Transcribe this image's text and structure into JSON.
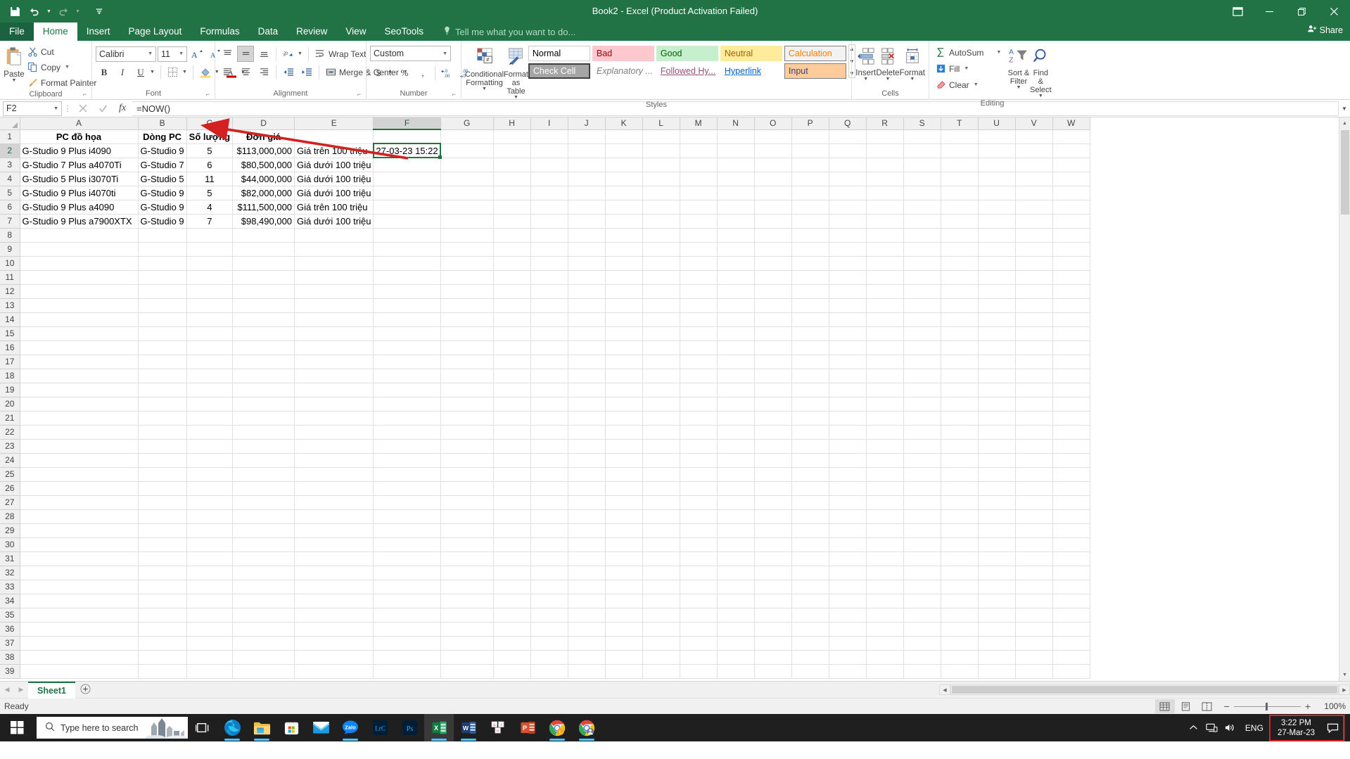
{
  "titlebar": {
    "title": "Book2 - Excel (Product Activation Failed)",
    "qat": [
      {
        "name": "save-icon",
        "label": "Save"
      },
      {
        "name": "undo-icon",
        "label": "Undo"
      },
      {
        "name": "redo-icon",
        "label": "Redo"
      },
      {
        "name": "customize-qat-icon",
        "label": "Customize Quick Access Toolbar"
      }
    ],
    "window_controls": [
      {
        "name": "ribbon-display-options",
        "label": "Ribbon Display Options"
      },
      {
        "name": "minimize",
        "label": "Minimize"
      },
      {
        "name": "restore",
        "label": "Restore Down"
      },
      {
        "name": "close",
        "label": "Close"
      }
    ]
  },
  "tabs": {
    "file": "File",
    "items": [
      "Home",
      "Insert",
      "Page Layout",
      "Formulas",
      "Data",
      "Review",
      "View",
      "SeoTools"
    ],
    "active": "Home",
    "tellme": "Tell me what you want to do...",
    "share": "Share"
  },
  "ribbon": {
    "clipboard": {
      "label": "Clipboard",
      "paste": "Paste",
      "cut": "Cut",
      "copy": "Copy",
      "format_painter": "Format Painter"
    },
    "font": {
      "label": "Font",
      "family": "Calibri",
      "size": "11",
      "grow": "A",
      "shrink": "A",
      "bold": "B",
      "italic": "I",
      "underline": "U",
      "borders": "Borders",
      "fill_color": "Fill Color",
      "font_color": "Font Color"
    },
    "alignment": {
      "label": "Alignment",
      "wrap_text": "Wrap Text",
      "merge_center": "Merge & Center",
      "orientation": "Orientation",
      "decrease_indent": "Decrease Indent",
      "increase_indent": "Increase Indent"
    },
    "number": {
      "label": "Number",
      "format": "Custom",
      "accounting": "$",
      "percent": "%",
      "comma": ",",
      "decrease_decimal": "Decrease Decimal",
      "increase_decimal": "Increase Decimal"
    },
    "styles": {
      "label": "Styles",
      "conditional_formatting": "Conditional Formatting",
      "format_as_table": "Format as Table",
      "gallery": [
        {
          "label": "Normal",
          "bg": "#ffffff",
          "fg": "#000000",
          "border": "#cccccc"
        },
        {
          "label": "Bad",
          "bg": "#ffc7ce",
          "fg": "#9c0006",
          "border": "#ffc7ce"
        },
        {
          "label": "Good",
          "bg": "#c6efce",
          "fg": "#006100",
          "border": "#c6efce"
        },
        {
          "label": "Neutral",
          "bg": "#ffeb9c",
          "fg": "#9c6500",
          "border": "#ffeb9c"
        },
        {
          "label": "Calculation",
          "bg": "#f2f2f2",
          "fg": "#fa7d00",
          "border": "#7f7f7f"
        },
        {
          "label": "Check Cell",
          "bg": "#a5a5a5",
          "fg": "#ffffff",
          "border": "#3f3f3f"
        },
        {
          "label": "Explanatory ...",
          "bg": "#ffffff",
          "fg": "#7f7f7f",
          "border": "#ffffff"
        },
        {
          "label": "Followed Hy...",
          "bg": "#ffffff",
          "fg": "#954f72",
          "border": "#ffffff"
        },
        {
          "label": "Hyperlink",
          "bg": "#ffffff",
          "fg": "#0563c1",
          "border": "#ffffff"
        },
        {
          "label": "Input",
          "bg": "#ffcc99",
          "fg": "#3f3f76",
          "border": "#7f7f7f"
        }
      ]
    },
    "cells": {
      "label": "Cells",
      "insert": "Insert",
      "delete": "Delete",
      "format": "Format"
    },
    "editing": {
      "label": "Editing",
      "autosum": "AutoSum",
      "fill": "Fill",
      "clear": "Clear",
      "sort_filter": "Sort & Filter",
      "find_select": "Find & Select"
    }
  },
  "formula_bar": {
    "name_box": "F2",
    "cancel": "Cancel",
    "enter": "Enter",
    "insert_function": "fx",
    "formula": "=NOW()"
  },
  "grid": {
    "columns": [
      "A",
      "B",
      "C",
      "D",
      "E",
      "F",
      "G",
      "H",
      "I",
      "J",
      "K",
      "L",
      "M",
      "N",
      "O",
      "P",
      "Q",
      "R",
      "S",
      "T",
      "U",
      "V",
      "W"
    ],
    "active_column": "F",
    "active_row": 2,
    "row_count": 39,
    "headers": [
      "PC đồ họa",
      "Dòng PC",
      "Số lượng",
      "Đơn giá",
      "",
      ""
    ],
    "rows": [
      {
        "a": "G-Studio 9 Plus i4090",
        "b": "G-Studio 9",
        "c": "5",
        "d": "$113,000,000",
        "e": "Giá trên 100 triệu",
        "f": "27-03-23 15:22"
      },
      {
        "a": "G-Studio 7 Plus a4070Ti",
        "b": "G-Studio 7",
        "c": "6",
        "d": "$80,500,000",
        "e": "Giá dưới 100 triệu",
        "f": ""
      },
      {
        "a": "G-Studio 5 Plus i3070Ti",
        "b": "G-Studio 5",
        "c": "11",
        "d": "$44,000,000",
        "e": "Giá dưới 100 triệu",
        "f": ""
      },
      {
        "a": "G-Studio 9 Plus i4070ti",
        "b": "G-Studio 9",
        "c": "5",
        "d": "$82,000,000",
        "e": "Giá dưới 100 triệu",
        "f": ""
      },
      {
        "a": "G-Studio 9 Plus a4090",
        "b": "G-Studio 9",
        "c": "4",
        "d": "$111,500,000",
        "e": "Giá trên 100 triệu",
        "f": ""
      },
      {
        "a": "G-Studio 9 Plus a7900XTX",
        "b": "G-Studio 9",
        "c": "7",
        "d": "$98,490,000",
        "e": "Giá dưới 100 triệu",
        "f": ""
      }
    ],
    "annotation_color": "#d32121"
  },
  "sheet_bar": {
    "sheets": [
      "Sheet1"
    ],
    "active": "Sheet1",
    "add_sheet": "New sheet"
  },
  "status_bar": {
    "status": "Ready",
    "views": [
      "Normal",
      "Page Layout",
      "Page Break Preview"
    ],
    "active_view": "Normal",
    "zoom": "100%",
    "zoom_out": "−",
    "zoom_in": "+"
  },
  "taskbar": {
    "search_placeholder": "Type here to search",
    "items": [
      {
        "name": "task-view-icon",
        "label": "Task View"
      },
      {
        "name": "edge-icon",
        "label": "Microsoft Edge"
      },
      {
        "name": "file-explorer-icon",
        "label": "File Explorer"
      },
      {
        "name": "microsoft-store-icon",
        "label": "Microsoft Store"
      },
      {
        "name": "mail-icon",
        "label": "Mail"
      },
      {
        "name": "zalo-icon",
        "label": "Zalo"
      },
      {
        "name": "lightroom-icon",
        "label": "Lightroom Classic"
      },
      {
        "name": "photoshop-icon",
        "label": "Photoshop"
      },
      {
        "name": "excel-icon",
        "label": "Excel"
      },
      {
        "name": "word-icon",
        "label": "Word"
      },
      {
        "name": "unikey-icon",
        "label": "Unikey"
      },
      {
        "name": "powerpoint-icon",
        "label": "PowerPoint"
      },
      {
        "name": "chrome-icon",
        "label": "Chrome"
      },
      {
        "name": "chrome-profile-icon",
        "label": "Chrome"
      }
    ],
    "tray": {
      "language": "ENG",
      "time": "3:22 PM",
      "date": "27-Mar-23",
      "highlight_color": "#e02020"
    }
  }
}
